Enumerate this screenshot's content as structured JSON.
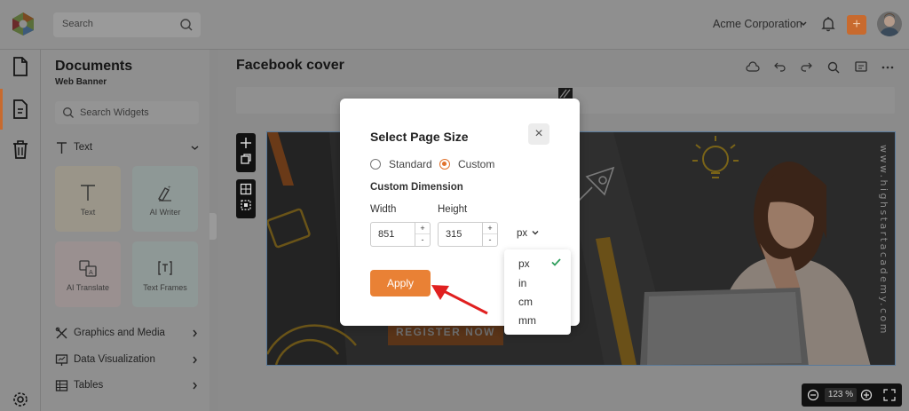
{
  "topbar": {
    "search_placeholder": "Search",
    "org_name": "Acme Corporation",
    "add_label": "+"
  },
  "panel": {
    "title": "Documents",
    "subtitle": "Web Banner",
    "widget_search_placeholder": "Search Widgets",
    "text_section": "Text",
    "tiles": [
      {
        "label": "Text",
        "icon": "text-icon"
      },
      {
        "label": "AI Writer",
        "icon": "ai-writer-icon"
      },
      {
        "label": "AI Translate",
        "icon": "ai-translate-icon"
      },
      {
        "label": "Text Frames",
        "icon": "text-frames-icon"
      }
    ],
    "sections": [
      "Graphics and Media",
      "Data Visualization",
      "Tables"
    ]
  },
  "main": {
    "document_title": "Facebook cover",
    "zoom": "123 %"
  },
  "banner": {
    "cta": "REGISTER NOW",
    "side_text": "www.highstartacademy.com"
  },
  "modal": {
    "title": "Select Page Size",
    "close": "×",
    "radio_standard": "Standard",
    "radio_custom": "Custom",
    "selected": "Custom",
    "custom_dimension": "Custom Dimension",
    "width_label": "Width",
    "height_label": "Height",
    "width_value": "851",
    "height_value": "315",
    "step_up": "+",
    "step_down": "-",
    "unit": "px",
    "apply": "Apply"
  },
  "unit_options": [
    "px",
    "in",
    "cm",
    "mm"
  ],
  "colors": {
    "accent": "#e98135",
    "check": "#2e9e5b",
    "arrow": "#e02020"
  }
}
